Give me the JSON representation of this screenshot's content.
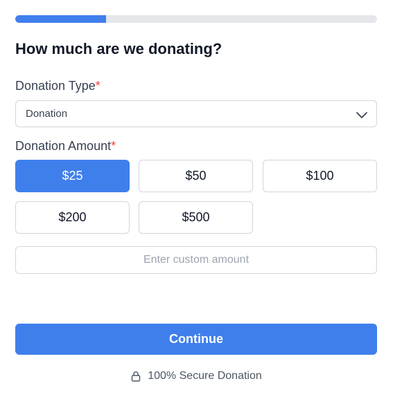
{
  "progress": {
    "fraction": 0.25
  },
  "heading": "How much are we donating?",
  "donation_type": {
    "label": "Donation Type",
    "required_mark": "*",
    "selected": "Donation",
    "icon": "chevron-down-icon"
  },
  "donation_amount": {
    "label": "Donation Amount",
    "required_mark": "*",
    "options": [
      "$25",
      "$50",
      "$100",
      "$200",
      "$500"
    ],
    "selected_index": 0,
    "custom_placeholder": "Enter custom amount",
    "custom_value": ""
  },
  "continue_label": "Continue",
  "secure_note": {
    "icon": "lock-icon",
    "text": "100% Secure Donation"
  },
  "colors": {
    "accent": "#3f7fec",
    "required": "#ef4444",
    "border": "#d1d5db",
    "track": "#e5e7eb"
  }
}
